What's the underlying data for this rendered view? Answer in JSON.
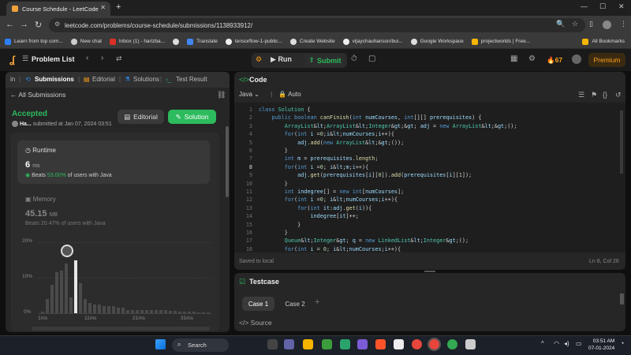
{
  "browser": {
    "tab_title": "Course Schedule - LeetCode",
    "url": "leetcode.com/problems/course-schedule/submissions/1138933912/",
    "bookmarks": [
      "Learn from top com...",
      "New chat",
      "Inbox (1) - harizba...",
      "",
      "Translate",
      "tensorflow-1-public...",
      "Create Website",
      "vijaychauhanssn/bui...",
      "Google Workspace",
      "projectworlds | Free...",
      "All Bookmarks"
    ]
  },
  "header": {
    "problem_list": "Problem List",
    "run": "Run",
    "submit": "Submit",
    "streak": "67",
    "premium": "Premium"
  },
  "left": {
    "tabs": [
      "in",
      "Submissions",
      "Editorial",
      "Solutions",
      "Test Result"
    ],
    "all_submissions": "All Submissions",
    "status": "Accepted",
    "user": "Ha...",
    "submitted": "submitted at Jan 07, 2024 03:51",
    "editorial_btn": "Editorial",
    "solution_btn": "Solution",
    "runtime_label": "Runtime",
    "runtime_value": "6",
    "runtime_unit": "ms",
    "runtime_beats_prefix": "Beats",
    "runtime_beats_pct": "53.00%",
    "runtime_beats_suffix": "of users with Java",
    "memory_label": "Memory",
    "memory_value": "45.15",
    "memory_unit": "MB",
    "memory_beats_prefix": "Beats",
    "memory_beats_pct": "20.47%",
    "memory_beats_suffix": "of users with Java"
  },
  "chart_data": {
    "type": "bar",
    "yticks": [
      "20%",
      "10%",
      "0%"
    ],
    "xticks": [
      "1ms",
      "11ms",
      "21ms",
      "31ms"
    ],
    "ylim": [
      0,
      20
    ],
    "values": [
      0.5,
      4,
      8,
      11.5,
      12,
      14,
      4.5,
      15,
      8.5,
      4,
      3,
      2.5,
      2.5,
      2,
      2,
      2,
      1.5,
      1.5,
      1,
      1,
      1,
      1,
      1,
      0.8,
      0.8,
      0.8,
      0.8,
      0.6,
      0.6,
      0.5,
      0.5,
      0.5,
      0.4,
      0.3,
      0.3,
      0.3
    ]
  },
  "code": {
    "title": "Code",
    "language": "Java",
    "mode": "Auto",
    "lines": [
      "class Solution {",
      "    public boolean canFinish(int numCourses, int[][] prerequisites) {",
      "        ArrayList<ArrayList<Integer>> adj = new ArrayList<>();",
      "        for(int i =0;i<numCourses;i++){",
      "            adj.add(new ArrayList<>());",
      "        }",
      "        int m = prerequisites.length;",
      "        for(int i =0; i<m;i++){",
      "            adj.get(prerequisites[i][0]).add(prerequisites[i][1]);",
      "        }",
      "        int indegree[] = new int[numCourses];",
      "        for(int i =0; i<numCourses;i++){",
      "            for(int it:adj.get(i)){",
      "                indegree[it]++;",
      "            }",
      "        }",
      "        Queue<Integer> q = new LinkedList<Integer>();",
      "        for(int i = 0; i<numCourses;i++){"
    ],
    "saved": "Saved to local",
    "cursor": "Ln 8, Col 26"
  },
  "testcase": {
    "title": "Testcase",
    "case1": "Case 1",
    "case2": "Case 2",
    "source": "Source"
  },
  "taskbar": {
    "search": "Search",
    "time": "03:51 AM",
    "date": "07-01-2024"
  }
}
